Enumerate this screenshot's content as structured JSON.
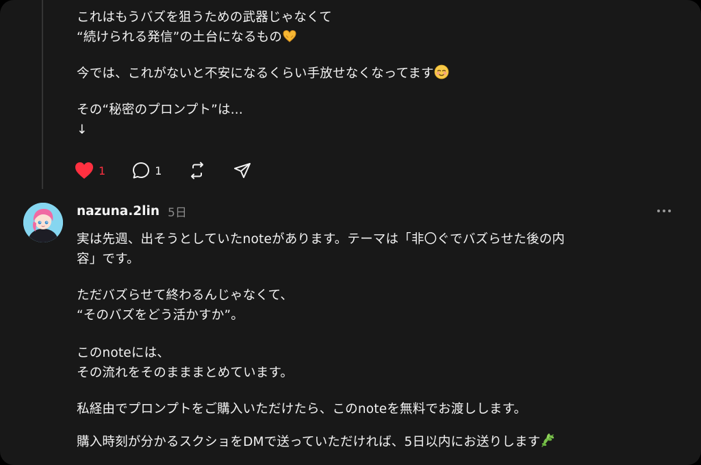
{
  "previous_post": {
    "paragraphs": [
      [
        "これはもうバズを狙うための武器じゃなくて",
        "“続けられる発信”の土台になるもの"
      ],
      [
        "今では、これがないと不安になるくらい手放せなくなってます"
      ],
      [
        "その“秘密のプロンプト”は...",
        "↓"
      ]
    ],
    "emojis": [
      "heart-hands-emoji",
      "smiling-face-emoji"
    ],
    "actions": {
      "like_count": "1",
      "reply_count": "1"
    }
  },
  "post": {
    "username": "nazuna.2lin",
    "timestamp": "5日",
    "paragraphs": [
      [
        "実は先週、出そうとしていたnoteがあります。テーマは「非〇ぐでバズらせた後の内",
        "容」です。"
      ],
      [
        "ただバズらせて終わるんじゃなくて、",
        "“そのバズをどう活かすか”。"
      ],
      [
        "このnoteには、",
        "その流れをそのまままとめています。"
      ],
      [
        "私経由でプロンプトをご購入いただけたら、このnoteを無料でお渡しします。"
      ],
      [
        "購入時刻が分かるスクショをDMで送っていただければ、5日以内にお送りします"
      ]
    ],
    "emojis": [
      "herb-emoji"
    ]
  },
  "colors": {
    "background": "#181818",
    "text": "#f3f3f3",
    "muted": "#8a8a8a",
    "like": "#ff3040",
    "thread_line": "#343434"
  }
}
